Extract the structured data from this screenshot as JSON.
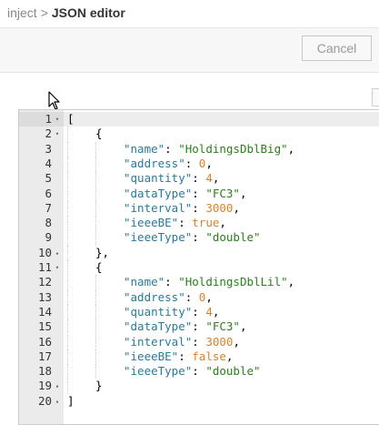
{
  "breadcrumb": {
    "parent": "inject",
    "separator": ">",
    "current": "JSON editor"
  },
  "toolbar": {
    "cancel_label": "Cancel"
  },
  "editor": {
    "lines": [
      {
        "n": "1",
        "fold": "▾",
        "indent": 0,
        "tokens": [
          {
            "t": "punc",
            "v": "["
          }
        ]
      },
      {
        "n": "2",
        "fold": "▾",
        "indent": 1,
        "tokens": [
          {
            "t": "punc",
            "v": "{"
          }
        ]
      },
      {
        "n": "3",
        "fold": "",
        "indent": 2,
        "tokens": [
          {
            "t": "key",
            "v": "\"name\""
          },
          {
            "t": "punc",
            "v": ": "
          },
          {
            "t": "str",
            "v": "\"HoldingsDblBig\""
          },
          {
            "t": "punc",
            "v": ","
          }
        ]
      },
      {
        "n": "4",
        "fold": "",
        "indent": 2,
        "tokens": [
          {
            "t": "key",
            "v": "\"address\""
          },
          {
            "t": "punc",
            "v": ": "
          },
          {
            "t": "num",
            "v": "0"
          },
          {
            "t": "punc",
            "v": ","
          }
        ]
      },
      {
        "n": "5",
        "fold": "",
        "indent": 2,
        "tokens": [
          {
            "t": "key",
            "v": "\"quantity\""
          },
          {
            "t": "punc",
            "v": ": "
          },
          {
            "t": "num",
            "v": "4"
          },
          {
            "t": "punc",
            "v": ","
          }
        ]
      },
      {
        "n": "6",
        "fold": "",
        "indent": 2,
        "tokens": [
          {
            "t": "key",
            "v": "\"dataType\""
          },
          {
            "t": "punc",
            "v": ": "
          },
          {
            "t": "str",
            "v": "\"FC3\""
          },
          {
            "t": "punc",
            "v": ","
          }
        ]
      },
      {
        "n": "7",
        "fold": "",
        "indent": 2,
        "tokens": [
          {
            "t": "key",
            "v": "\"interval\""
          },
          {
            "t": "punc",
            "v": ": "
          },
          {
            "t": "num",
            "v": "3000"
          },
          {
            "t": "punc",
            "v": ","
          }
        ]
      },
      {
        "n": "8",
        "fold": "",
        "indent": 2,
        "tokens": [
          {
            "t": "key",
            "v": "\"ieeeBE\""
          },
          {
            "t": "punc",
            "v": ": "
          },
          {
            "t": "bool",
            "v": "true"
          },
          {
            "t": "punc",
            "v": ","
          }
        ]
      },
      {
        "n": "9",
        "fold": "",
        "indent": 2,
        "tokens": [
          {
            "t": "key",
            "v": "\"ieeeType\""
          },
          {
            "t": "punc",
            "v": ": "
          },
          {
            "t": "str",
            "v": "\"double\""
          }
        ]
      },
      {
        "n": "10",
        "fold": "▴",
        "indent": 1,
        "tokens": [
          {
            "t": "punc",
            "v": "},"
          }
        ]
      },
      {
        "n": "11",
        "fold": "▾",
        "indent": 1,
        "tokens": [
          {
            "t": "punc",
            "v": "{"
          }
        ]
      },
      {
        "n": "12",
        "fold": "",
        "indent": 2,
        "tokens": [
          {
            "t": "key",
            "v": "\"name\""
          },
          {
            "t": "punc",
            "v": ": "
          },
          {
            "t": "str",
            "v": "\"HoldingsDblLil\""
          },
          {
            "t": "punc",
            "v": ","
          }
        ]
      },
      {
        "n": "13",
        "fold": "",
        "indent": 2,
        "tokens": [
          {
            "t": "key",
            "v": "\"address\""
          },
          {
            "t": "punc",
            "v": ": "
          },
          {
            "t": "num",
            "v": "0"
          },
          {
            "t": "punc",
            "v": ","
          }
        ]
      },
      {
        "n": "14",
        "fold": "",
        "indent": 2,
        "tokens": [
          {
            "t": "key",
            "v": "\"quantity\""
          },
          {
            "t": "punc",
            "v": ": "
          },
          {
            "t": "num",
            "v": "4"
          },
          {
            "t": "punc",
            "v": ","
          }
        ]
      },
      {
        "n": "15",
        "fold": "",
        "indent": 2,
        "tokens": [
          {
            "t": "key",
            "v": "\"dataType\""
          },
          {
            "t": "punc",
            "v": ": "
          },
          {
            "t": "str",
            "v": "\"FC3\""
          },
          {
            "t": "punc",
            "v": ","
          }
        ]
      },
      {
        "n": "16",
        "fold": "",
        "indent": 2,
        "tokens": [
          {
            "t": "key",
            "v": "\"interval\""
          },
          {
            "t": "punc",
            "v": ": "
          },
          {
            "t": "num",
            "v": "3000"
          },
          {
            "t": "punc",
            "v": ","
          }
        ]
      },
      {
        "n": "17",
        "fold": "",
        "indent": 2,
        "tokens": [
          {
            "t": "key",
            "v": "\"ieeeBE\""
          },
          {
            "t": "punc",
            "v": ": "
          },
          {
            "t": "bool",
            "v": "false"
          },
          {
            "t": "punc",
            "v": ","
          }
        ]
      },
      {
        "n": "18",
        "fold": "",
        "indent": 2,
        "tokens": [
          {
            "t": "key",
            "v": "\"ieeeType\""
          },
          {
            "t": "punc",
            "v": ": "
          },
          {
            "t": "str",
            "v": "\"double\""
          }
        ]
      },
      {
        "n": "19",
        "fold": "▴",
        "indent": 1,
        "tokens": [
          {
            "t": "punc",
            "v": "}"
          }
        ]
      },
      {
        "n": "20",
        "fold": "▴",
        "indent": 0,
        "tokens": [
          {
            "t": "punc",
            "v": "]"
          }
        ]
      }
    ],
    "active_line": "1"
  },
  "colors": {
    "key": "#2a7a9a",
    "string": "#2a7f1a",
    "number": "#d9822b",
    "gutter": "#ebebeb"
  }
}
